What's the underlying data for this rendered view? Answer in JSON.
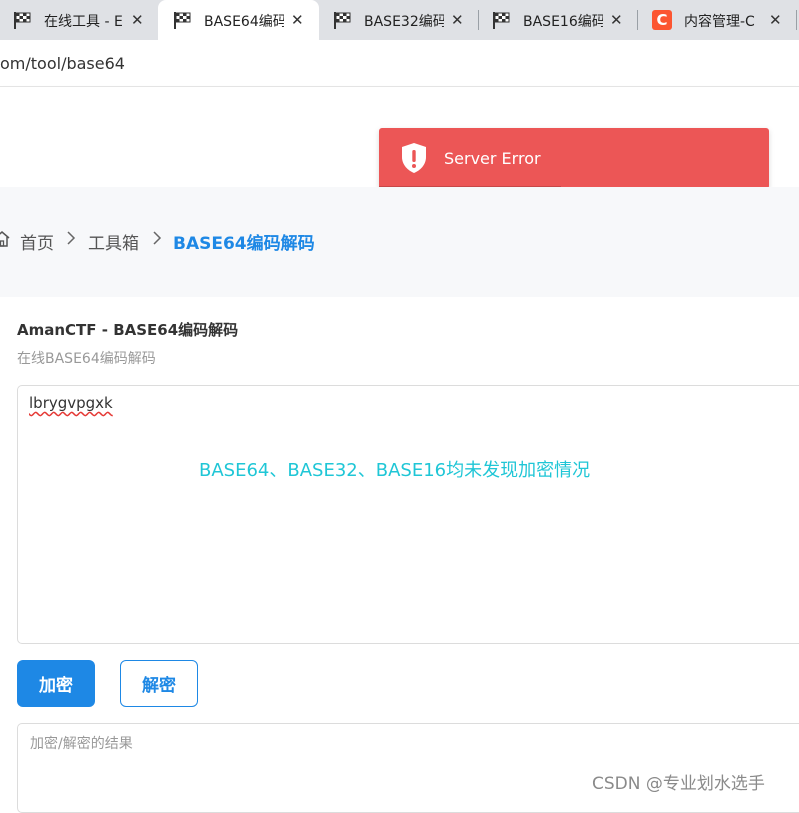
{
  "browser": {
    "tabs": [
      {
        "title": "在线工具 - E",
        "icon": "checkered-flag-icon",
        "active": false
      },
      {
        "title": "BASE64编码",
        "icon": "checkered-flag-icon",
        "active": true
      },
      {
        "title": "BASE32编码",
        "icon": "checkered-flag-icon",
        "active": false
      },
      {
        "title": "BASE16编码",
        "icon": "checkered-flag-icon",
        "active": false
      },
      {
        "title": "内容管理-C",
        "icon": "csdn-logo-icon",
        "active": false
      }
    ],
    "close_glyph": "✕",
    "csdn_letter": "C",
    "url": "om/tool/base64"
  },
  "toast": {
    "message": "Server Error",
    "icon": "shield-alert-icon",
    "color": "#ec5656"
  },
  "breadcrumb": {
    "items": [
      "首页",
      "工具箱",
      "BASE64编码解码"
    ]
  },
  "card": {
    "title": "AmanCTF - BASE64编码解码",
    "subtitle": "在线BASE64编码解码"
  },
  "input": {
    "value": "lbrygvpgxk"
  },
  "annotation": "BASE64、BASE32、BASE16均未发现加密情况",
  "buttons": {
    "encrypt": "加密",
    "decrypt": "解密"
  },
  "result": {
    "placeholder": "加密/解密的结果"
  },
  "watermark": "CSDN @专业划水选手",
  "colors": {
    "accent": "#1e88e5",
    "annotation": "#1fc6d6",
    "error": "#ec5656"
  }
}
